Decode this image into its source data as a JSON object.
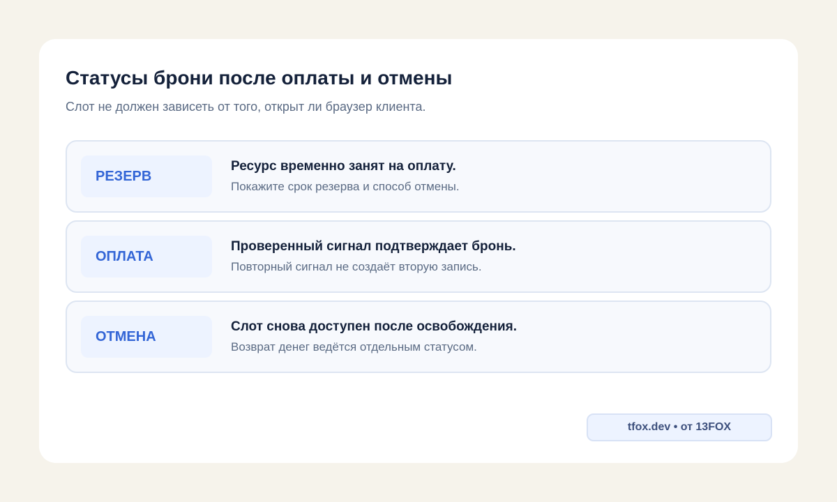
{
  "header": {
    "title": "Статусы брони после оплаты и отмены",
    "subtitle": "Слот не должен зависеть от того, открыт ли браузер клиента."
  },
  "statuses": [
    {
      "label": "РЕЗЕРВ",
      "heading": "Ресурс временно занят на оплату.",
      "note": "Покажите срок резерва и способ отмены."
    },
    {
      "label": "ОПЛАТА",
      "heading": "Проверенный сигнал подтверждает бронь.",
      "note": "Повторный сигнал не создаёт вторую запись."
    },
    {
      "label": "ОТМЕНА",
      "heading": "Слот снова доступен после освобождения.",
      "note": "Возврат денег ведётся отдельным статусом."
    }
  ],
  "footer": {
    "brand": "tfox.dev • от 13FOX"
  },
  "colors": {
    "background": "#f6f3eb",
    "card": "#ffffff",
    "accent": "#3365d6",
    "title": "#14213a",
    "muted": "#5b6b84"
  }
}
